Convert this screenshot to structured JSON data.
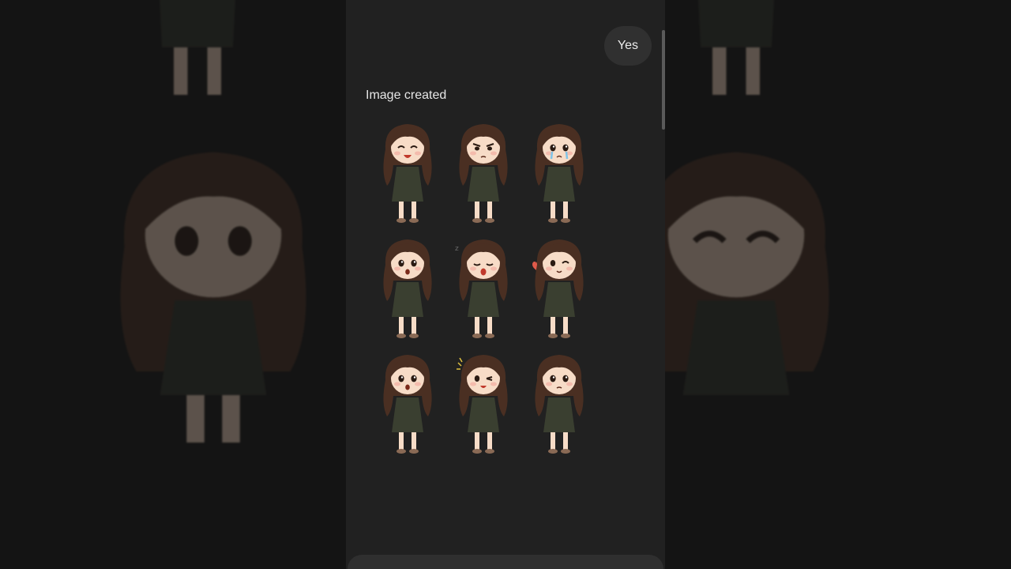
{
  "chat": {
    "user_message": "Yes",
    "assistant_status": "Image created"
  },
  "stickers": [
    {
      "expression": "laughing"
    },
    {
      "expression": "angry"
    },
    {
      "expression": "crying"
    },
    {
      "expression": "surprised"
    },
    {
      "expression": "yawning"
    },
    {
      "expression": "winking-heart"
    },
    {
      "expression": "shocked"
    },
    {
      "expression": "excited-wink"
    },
    {
      "expression": "shy"
    }
  ],
  "colors": {
    "app_bg": "#212121",
    "bubble_bg": "#303030",
    "hair": "#4a2f22",
    "dress": "#3a3f30",
    "skin": "#f7dcc7"
  }
}
